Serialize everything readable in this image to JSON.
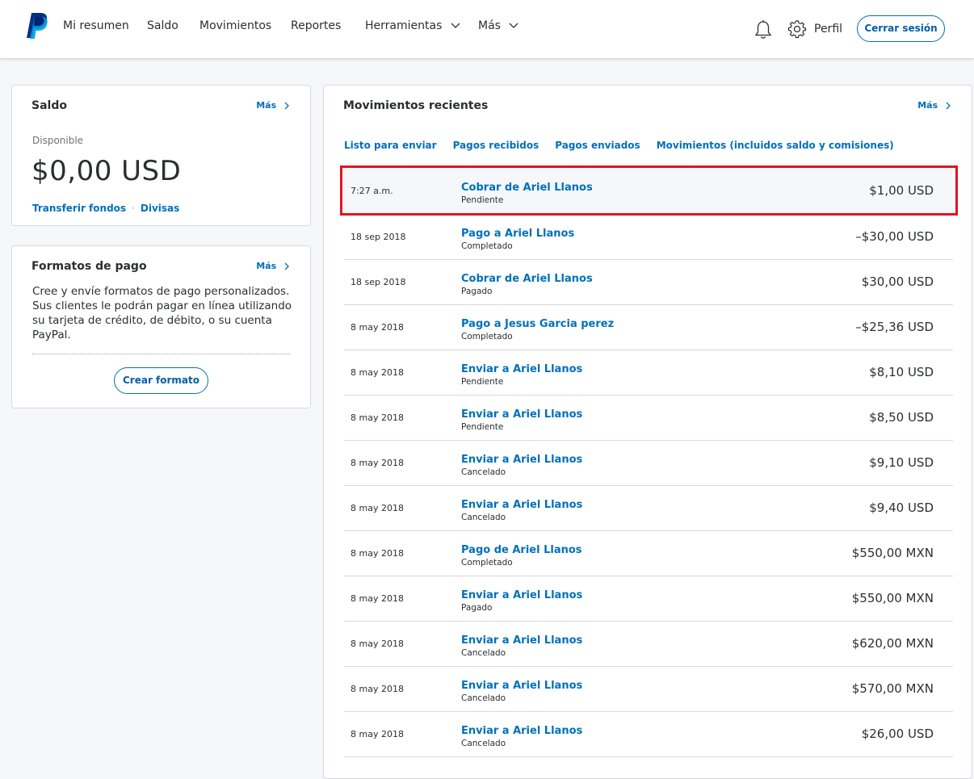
{
  "nav": {
    "items": [
      {
        "label": "Mi resumen"
      },
      {
        "label": "Saldo"
      },
      {
        "label": "Movimientos"
      },
      {
        "label": "Reportes"
      },
      {
        "label": "Herramientas"
      },
      {
        "label": "Más"
      }
    ],
    "profile_label": "Perfil",
    "logout_label": "Cerrar sesión"
  },
  "saldo": {
    "title": "Saldo",
    "more": "Más",
    "available_label": "Disponible",
    "balance": "$0,00 USD",
    "transfer_link": "Transferir fondos",
    "separator": "·",
    "currency_link": "Divisas"
  },
  "formatos": {
    "title": "Formatos de pago",
    "more": "Más",
    "description": "Cree y envíe formatos de pago personalizados. Sus clientes le podrán pagar en línea utilizando su tarjeta de crédito, de débito, o su cuenta PayPal.",
    "button": "Crear formato"
  },
  "movimientos": {
    "title": "Movimientos recientes",
    "more": "Más",
    "tabs": [
      "Listo para enviar",
      "Pagos recibidos",
      "Pagos enviados",
      "Movimientos (incluidos saldo y comisiones)"
    ],
    "transactions": [
      {
        "date": "7:27 a.m.",
        "name": "Cobrar de Ariel Llanos",
        "status": "Pendiente",
        "amount": "$1,00 USD"
      },
      {
        "date": "18 sep 2018",
        "name": "Pago a Ariel Llanos",
        "status": "Completado",
        "amount": "–$30,00 USD"
      },
      {
        "date": "18 sep 2018",
        "name": "Cobrar de Ariel Llanos",
        "status": "Pagado",
        "amount": "$30,00 USD"
      },
      {
        "date": "8 may 2018",
        "name": "Pago a Jesus Garcia perez",
        "status": "Completado",
        "amount": "–$25,36 USD"
      },
      {
        "date": "8 may 2018",
        "name": "Enviar a Ariel Llanos",
        "status": "Pendiente",
        "amount": "$8,10 USD"
      },
      {
        "date": "8 may 2018",
        "name": "Enviar a Ariel Llanos",
        "status": "Pendiente",
        "amount": "$8,50 USD"
      },
      {
        "date": "8 may 2018",
        "name": "Enviar a Ariel Llanos",
        "status": "Cancelado",
        "amount": "$9,10 USD"
      },
      {
        "date": "8 may 2018",
        "name": "Enviar a Ariel Llanos",
        "status": "Cancelado",
        "amount": "$9,40 USD"
      },
      {
        "date": "8 may 2018",
        "name": "Pago de Ariel Llanos",
        "status": "Completado",
        "amount": "$550,00 MXN"
      },
      {
        "date": "8 may 2018",
        "name": "Enviar a Ariel Llanos",
        "status": "Pagado",
        "amount": "$550,00 MXN"
      },
      {
        "date": "8 may 2018",
        "name": "Enviar a Ariel Llanos",
        "status": "Cancelado",
        "amount": "$620,00 MXN"
      },
      {
        "date": "8 may 2018",
        "name": "Enviar a Ariel Llanos",
        "status": "Cancelado",
        "amount": "$570,00 MXN"
      },
      {
        "date": "8 may 2018",
        "name": "Enviar a Ariel Llanos",
        "status": "Cancelado",
        "amount": "$26,00 USD"
      }
    ]
  },
  "colors": {
    "brand_blue": "#0070ba",
    "highlight_red": "#e2141f"
  },
  "icons": [
    "paypal-logo",
    "chevron-down-icon",
    "bell-icon",
    "gear-icon",
    "chevron-right-icon"
  ]
}
